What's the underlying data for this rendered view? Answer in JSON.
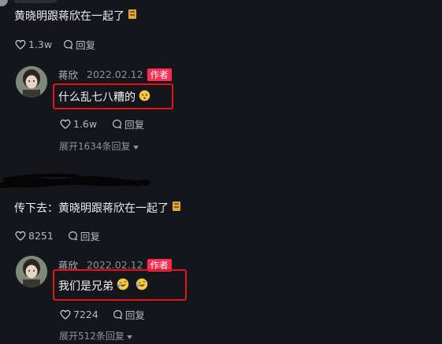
{
  "comments": [
    {
      "text": "黄晓明跟蒋欣在一起了",
      "emoji": "badge-emoji",
      "likes": "1.3w",
      "reply_label": "回复",
      "reply": {
        "author": "蒋欣",
        "date": "2022.02.12",
        "author_badge": "作者",
        "text": "什么乱七八糟的",
        "emoji": "dizzy-face-emoji",
        "likes": "1.6w",
        "reply_label": "回复",
        "expand_label": "展开1634条回复"
      }
    },
    {
      "text": "传下去：黄晓明跟蒋欣在一起了",
      "emoji": "badge-emoji",
      "likes": "8251",
      "reply_label": "回复",
      "reply": {
        "author": "蒋欣",
        "date": "2022.02.12",
        "author_badge": "作者",
        "text": "我们是兄弟",
        "emoji": "rolling-laughing-emoji",
        "likes": "7224",
        "reply_label": "回复",
        "expand_label": "展开512条回复"
      }
    }
  ],
  "colors": {
    "background": "#15161c",
    "highlight_box": "#e0161e",
    "author_badge": "#fe2c55"
  }
}
